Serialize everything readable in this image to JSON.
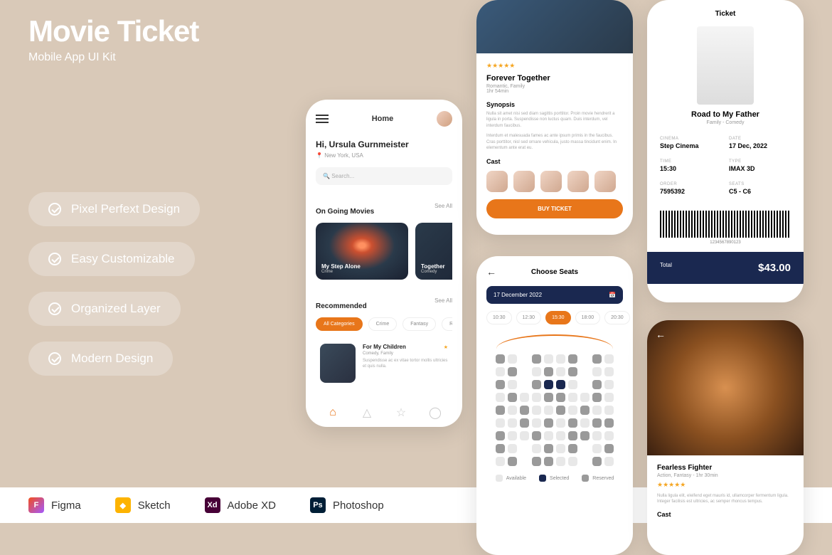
{
  "hero": {
    "title": "Movie Ticket",
    "subtitle": "Mobile App UI Kit"
  },
  "features": [
    "Pixel Perfext Design",
    "Easy Customizable",
    "Organized Layer",
    "Modern Design"
  ],
  "software": [
    "Figma",
    "Sketch",
    "Adobe XD",
    "Photoshop"
  ],
  "home": {
    "title": "Home",
    "greeting": "Hi, Ursula Gurnmeister",
    "location": "New York, USA",
    "search_placeholder": "Search...",
    "ongoing_label": "On Going Movies",
    "see_all": "See All",
    "movies": [
      {
        "title": "My Step Alone",
        "genre": "Crime"
      },
      {
        "title": "Together",
        "genre": "Comedy"
      }
    ],
    "rec_label": "Recommended",
    "categories": [
      "All Categories",
      "Crime",
      "Fantasy",
      "Romantic"
    ],
    "rec": {
      "title": "For My Children",
      "genre": "Comedy, Family",
      "desc": "Suspendisse ac ex vitae tortor mollis ultricies et quis nulla."
    }
  },
  "detail": {
    "title": "Forever Together",
    "tags": "Romantic, Family",
    "duration": "1hr 54min",
    "synopsis_label": "Synopsis",
    "synopsis1": "Nulla sit amet nisi sed diam sagittis porttitor. Proin movie hendrerit a ligula in porta. Suspendisse non luctus quam. Duis interdum, vel interdum faucibus.",
    "synopsis2": "Interdum et malesuada fames ac ante ipsum primis in the faucibus. Cras porttitor, nisl sed ornare vehicula, justo massa tincidunt enim. In elementum ante erat eu.",
    "cast_label": "Cast",
    "buy": "BUY TICKET"
  },
  "seats": {
    "title": "Choose Seats",
    "date": "17 December 2022",
    "times": [
      "10:30",
      "12:30",
      "15:30",
      "18:00",
      "20:30"
    ],
    "legend": {
      "available": "Available",
      "selected": "Selected",
      "reserved": "Reserved"
    }
  },
  "ticket": {
    "heading": "Ticket",
    "movie": "Road to My Father",
    "genre": "Family - Comedy",
    "cinema_l": "CINEMA",
    "cinema_v": "Step Cinema",
    "date_l": "DATE",
    "date_v": "17 Dec, 2022",
    "time_l": "TIME",
    "time_v": "15:30",
    "type_l": "TYPE",
    "type_v": "IMAX 3D",
    "order_l": "ORDER",
    "order_v": "7595392",
    "seats_l": "SEATS",
    "seats_v": "C5 - C6",
    "barcode": "1234567890123",
    "total_l": "Total",
    "total_v": "$43.00"
  },
  "fighter": {
    "title": "Fearless Fighter",
    "tags": "Action, Fantasy  -  1hr 30min",
    "desc": "Nulla ligula elit, eleifend eget mauris id, ullamcorper fermentum ligula. Integer facilisis est ultricies, ac semper rhoncus tempus.",
    "cast_label": "Cast"
  }
}
